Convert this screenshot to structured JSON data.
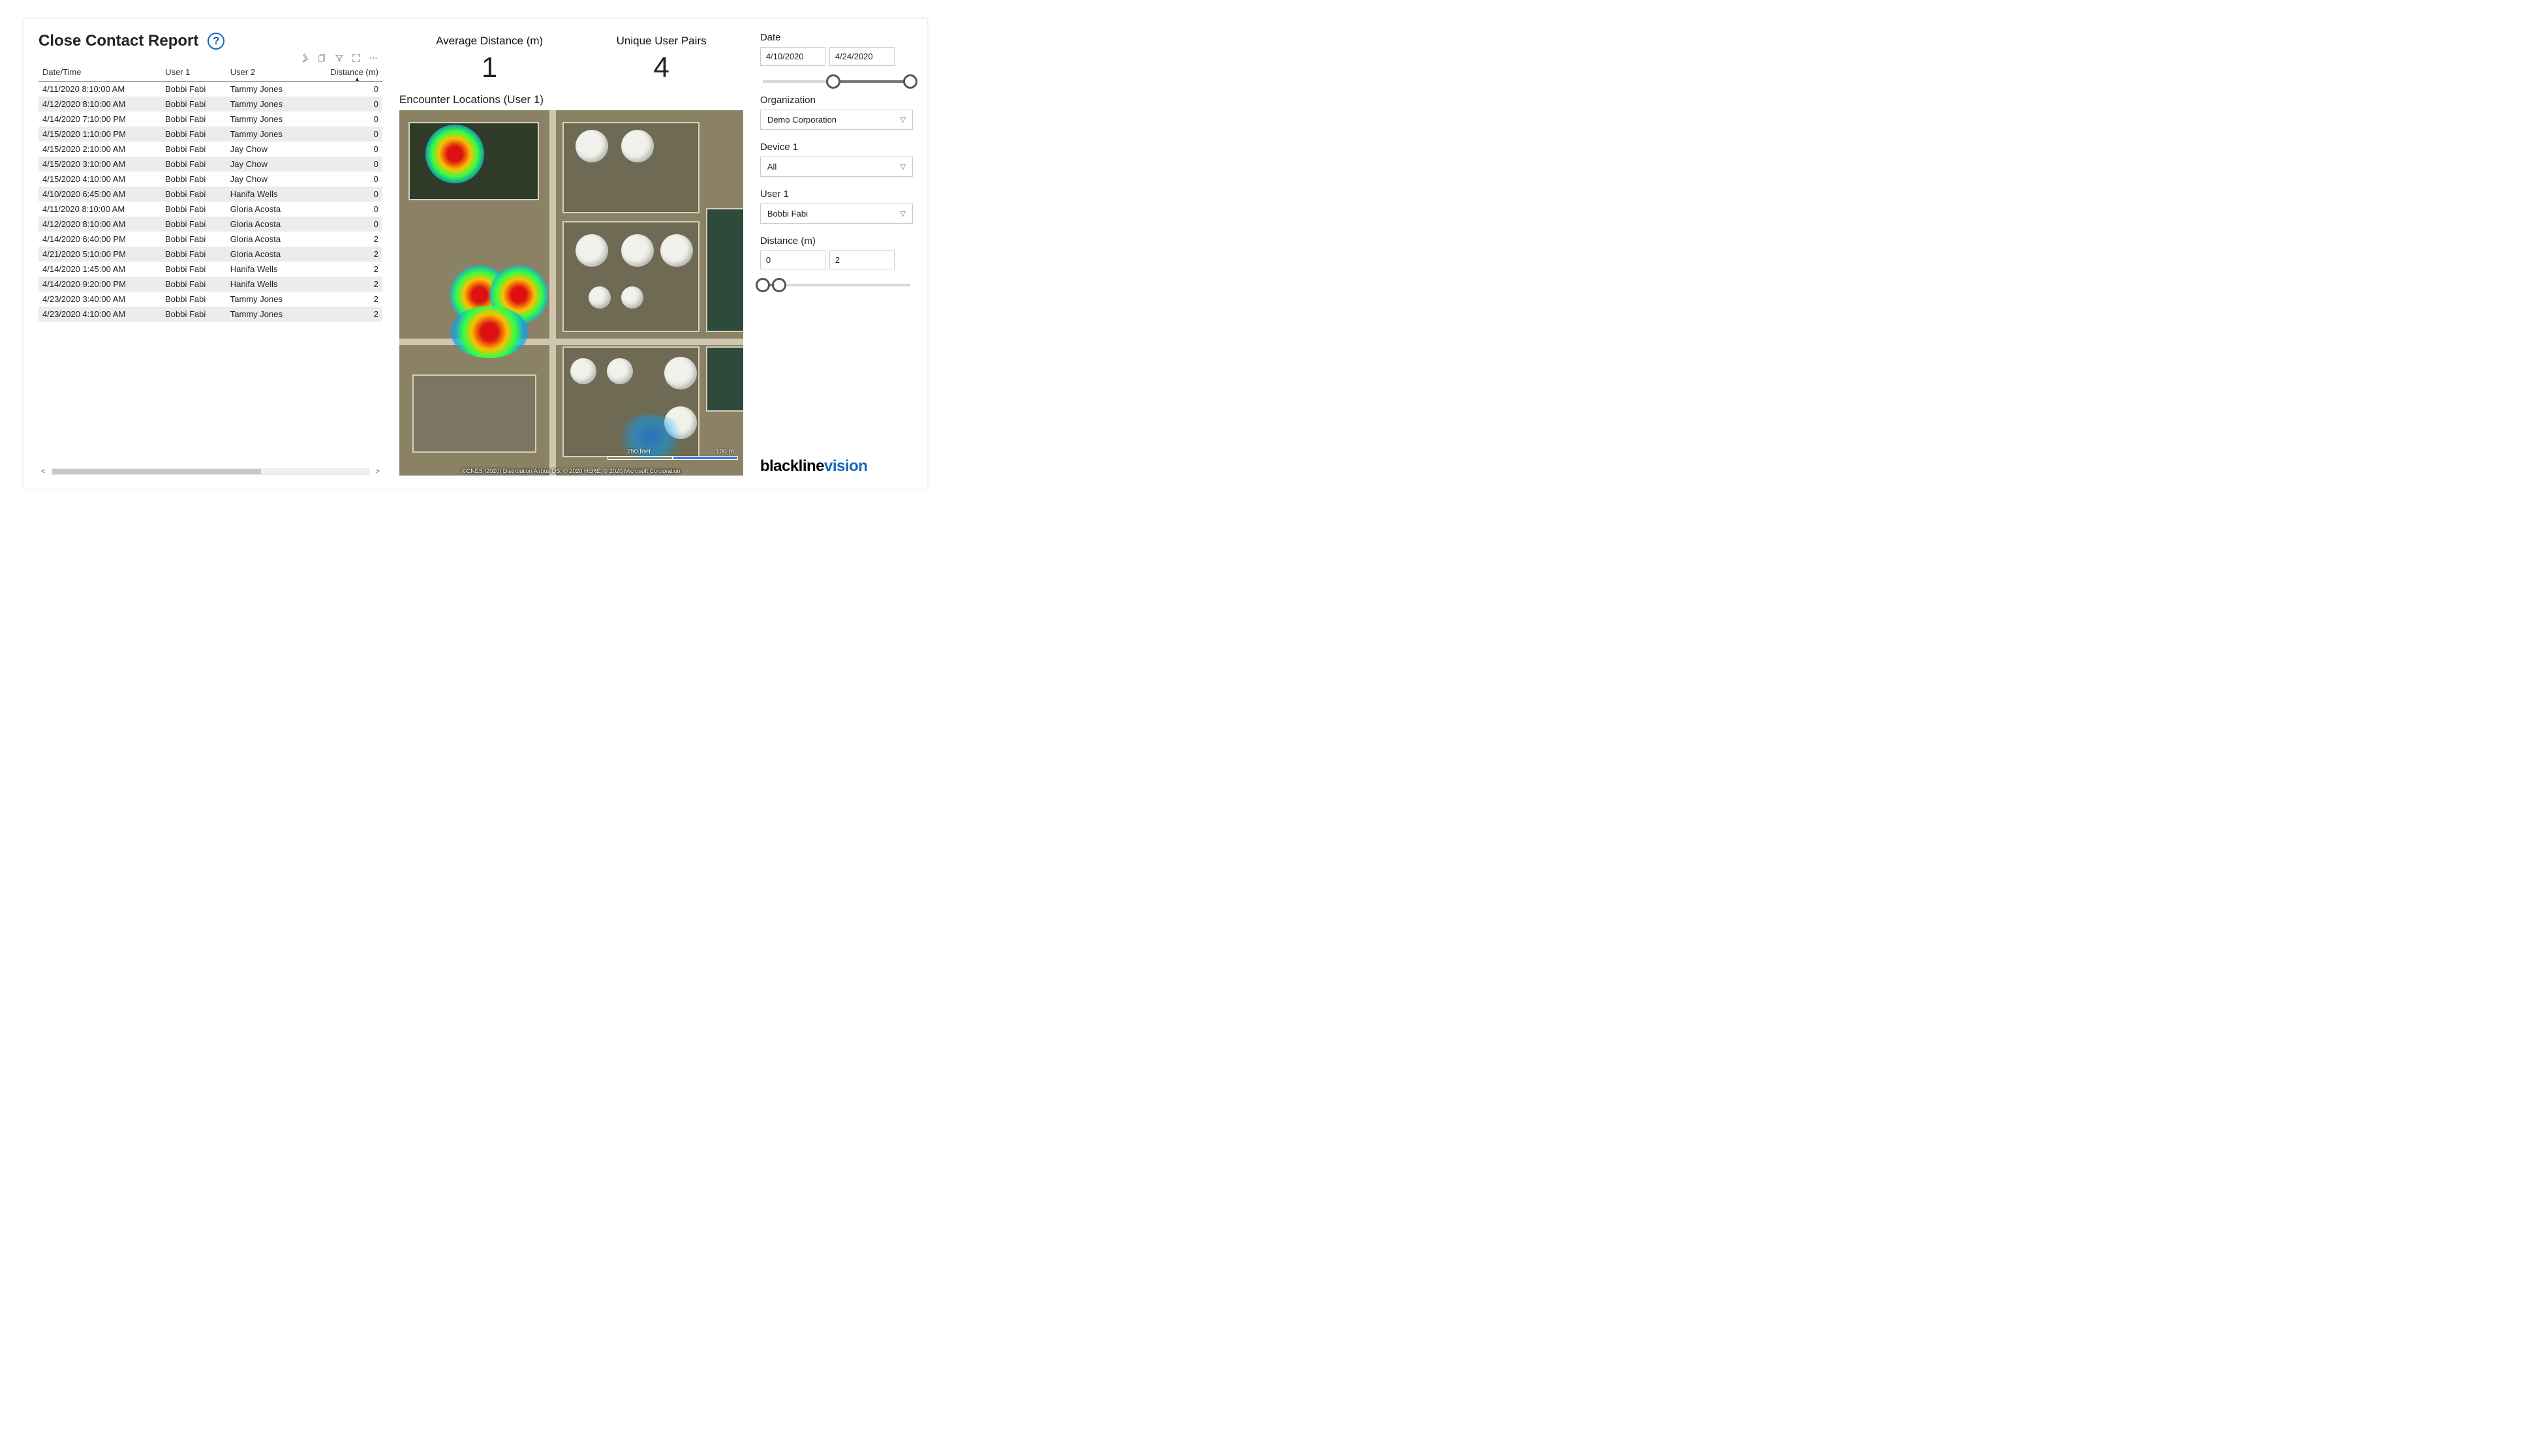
{
  "title": "Close Contact Report",
  "help_label": "?",
  "table": {
    "headers": {
      "datetime": "Date/Time",
      "user1": "User 1",
      "user2": "User 2",
      "distance": "Distance (m)"
    },
    "rows": [
      {
        "datetime": "4/11/2020 8:10:00 AM",
        "user1": "Bobbi Fabi",
        "user2": "Tammy Jones",
        "distance": "0"
      },
      {
        "datetime": "4/12/2020 8:10:00 AM",
        "user1": "Bobbi Fabi",
        "user2": "Tammy Jones",
        "distance": "0"
      },
      {
        "datetime": "4/14/2020 7:10:00 PM",
        "user1": "Bobbi Fabi",
        "user2": "Tammy Jones",
        "distance": "0"
      },
      {
        "datetime": "4/15/2020 1:10:00 PM",
        "user1": "Bobbi Fabi",
        "user2": "Tammy Jones",
        "distance": "0"
      },
      {
        "datetime": "4/15/2020 2:10:00 AM",
        "user1": "Bobbi Fabi",
        "user2": "Jay Chow",
        "distance": "0"
      },
      {
        "datetime": "4/15/2020 3:10:00 AM",
        "user1": "Bobbi Fabi",
        "user2": "Jay Chow",
        "distance": "0"
      },
      {
        "datetime": "4/15/2020 4:10:00 AM",
        "user1": "Bobbi Fabi",
        "user2": "Jay Chow",
        "distance": "0"
      },
      {
        "datetime": "4/10/2020 6:45:00 AM",
        "user1": "Bobbi Fabi",
        "user2": "Hanifa Wells",
        "distance": "0"
      },
      {
        "datetime": "4/11/2020 8:10:00 AM",
        "user1": "Bobbi Fabi",
        "user2": "Gloria Acosta",
        "distance": "0"
      },
      {
        "datetime": "4/12/2020 8:10:00 AM",
        "user1": "Bobbi Fabi",
        "user2": "Gloria Acosta",
        "distance": "0"
      },
      {
        "datetime": "4/14/2020 6:40:00 PM",
        "user1": "Bobbi Fabi",
        "user2": "Gloria Acosta",
        "distance": "2"
      },
      {
        "datetime": "4/21/2020 5:10:00 PM",
        "user1": "Bobbi Fabi",
        "user2": "Gloria Acosta",
        "distance": "2"
      },
      {
        "datetime": "4/14/2020 1:45:00 AM",
        "user1": "Bobbi Fabi",
        "user2": "Hanifa Wells",
        "distance": "2"
      },
      {
        "datetime": "4/14/2020 9:20:00 PM",
        "user1": "Bobbi Fabi",
        "user2": "Hanifa Wells",
        "distance": "2"
      },
      {
        "datetime": "4/23/2020 3:40:00 AM",
        "user1": "Bobbi Fabi",
        "user2": "Tammy Jones",
        "distance": "2"
      },
      {
        "datetime": "4/23/2020 4:10:00 AM",
        "user1": "Bobbi Fabi",
        "user2": "Tammy Jones",
        "distance": "2"
      }
    ]
  },
  "stats": {
    "avg_distance_label": "Average Distance (m)",
    "avg_distance_value": "1",
    "unique_pairs_label": "Unique User Pairs",
    "unique_pairs_value": "4"
  },
  "map": {
    "title": "Encounter Locations (User 1)",
    "scale_feet": "250 feet",
    "scale_m": "100 m",
    "attribution": "©CNES (2020) Distribution Airbus DS, © 2020 HERE, © 2020 Microsoft Corporation"
  },
  "filters": {
    "date_label": "Date",
    "date_from": "4/10/2020",
    "date_to": "4/24/2020",
    "org_label": "Organization",
    "org_value": "Demo Corporation",
    "device_label": "Device 1",
    "device_value": "All",
    "user_label": "User 1",
    "user_value": "Bobbi Fabi",
    "distance_label": "Distance (m)",
    "distance_min": "0",
    "distance_max": "2"
  },
  "brand": {
    "a": "blackline",
    "b": "vision"
  }
}
